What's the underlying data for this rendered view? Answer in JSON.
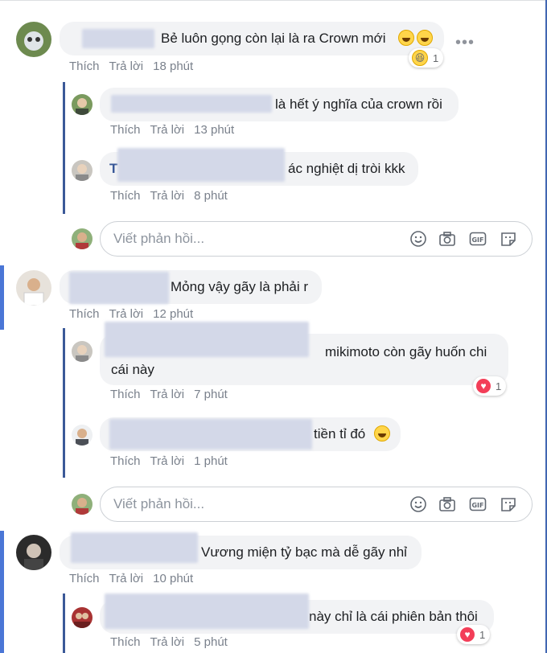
{
  "comments": [
    {
      "text": "Bẻ luôn gọng còn lại là ra Crown mới",
      "reaction_count": "1",
      "reaction": "laugh-icon",
      "actions": {
        "like": "Thích",
        "reply": "Trả lời",
        "time": "18 phút"
      }
    },
    {
      "text": "Mỏng vậy gãy là phải r",
      "actions": {
        "like": "Thích",
        "reply": "Trả lời",
        "time": "12 phút"
      }
    },
    {
      "text": "Vương miện tỷ bạc mà dễ gãy nhỉ",
      "actions": {
        "like": "Thích",
        "reply": "Trả lời",
        "time": "10 phút"
      }
    }
  ],
  "replies": [
    {
      "text": "là hết ý nghĩa của crown rồi",
      "actions": {
        "like": "Thích",
        "reply": "Trả lời",
        "time": "13 phút"
      }
    },
    {
      "text": "ác nghiệt dị tròi kkk",
      "name_initial": "T",
      "actions": {
        "like": "Thích",
        "reply": "Trả lời",
        "time": "8 phút"
      }
    },
    {
      "text": "mikimoto còn gãy huốn chi cái này",
      "reaction_count": "1",
      "reaction": "heart-icon",
      "actions": {
        "like": "Thích",
        "reply": "Trả lời",
        "time": "7 phút"
      }
    },
    {
      "text": "tiền tỉ đó",
      "actions": {
        "like": "Thích",
        "reply": "Trả lời",
        "time": "1 phút"
      }
    },
    {
      "text": "này chỉ là cái phiên bản thôi",
      "reaction_count": "1",
      "reaction": "heart-icon",
      "actions": {
        "like": "Thích",
        "reply": "Trả lời",
        "time": "5 phút"
      }
    }
  ],
  "reply_box": {
    "placeholder": "Viết phản hồi..."
  },
  "icons": [
    "smile-icon",
    "camera-icon",
    "gif-icon",
    "sticker-icon"
  ],
  "colors": {
    "accent": "#4a76d6",
    "heart": "#f33e58",
    "laugh": "#ffd54a",
    "link": "#385898"
  }
}
